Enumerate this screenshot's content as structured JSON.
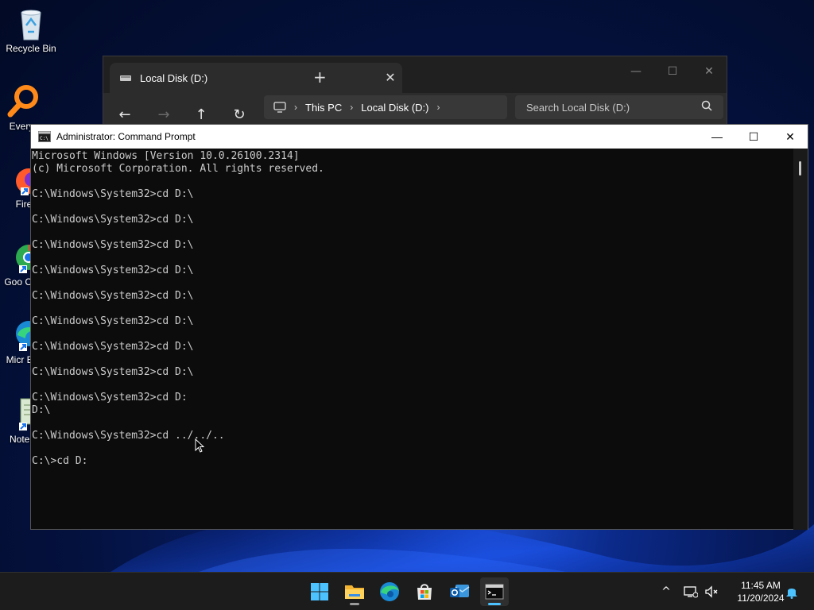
{
  "desktop": {
    "icons": [
      {
        "label": "Recycle Bin"
      },
      {
        "label": "Every"
      },
      {
        "label": "Fire"
      },
      {
        "label": "Goo Chr"
      },
      {
        "label": "Micr Ed"
      },
      {
        "label": "Notep"
      }
    ]
  },
  "explorer": {
    "tab_title": "Local Disk (D:)",
    "breadcrumb": [
      "This PC",
      "Local Disk (D:)"
    ],
    "search_placeholder": "Search Local Disk (D:)"
  },
  "cmd": {
    "title": "Administrator: Command Prompt",
    "lines": [
      "Microsoft Windows [Version 10.0.26100.2314]",
      "(c) Microsoft Corporation. All rights reserved.",
      "",
      "C:\\Windows\\System32>cd D:\\",
      "",
      "C:\\Windows\\System32>cd D:\\",
      "",
      "C:\\Windows\\System32>cd D:\\",
      "",
      "C:\\Windows\\System32>cd D:\\",
      "",
      "C:\\Windows\\System32>cd D:\\",
      "",
      "C:\\Windows\\System32>cd D:\\",
      "",
      "C:\\Windows\\System32>cd D:\\",
      "",
      "C:\\Windows\\System32>cd D:\\",
      "",
      "C:\\Windows\\System32>cd D:",
      "D:\\",
      "",
      "C:\\Windows\\System32>cd ../../..",
      "",
      "C:\\>cd D:"
    ]
  },
  "taskbar": {
    "apps": [
      {
        "name": "start"
      },
      {
        "name": "file-explorer"
      },
      {
        "name": "edge"
      },
      {
        "name": "store"
      },
      {
        "name": "outlook"
      },
      {
        "name": "terminal"
      }
    ],
    "time": "11:45 AM",
    "date": "11/20/2024"
  },
  "colors": {
    "console_bg": "#0c0c0c",
    "console_text": "#cccccc",
    "accent": "#4cc2ff"
  }
}
